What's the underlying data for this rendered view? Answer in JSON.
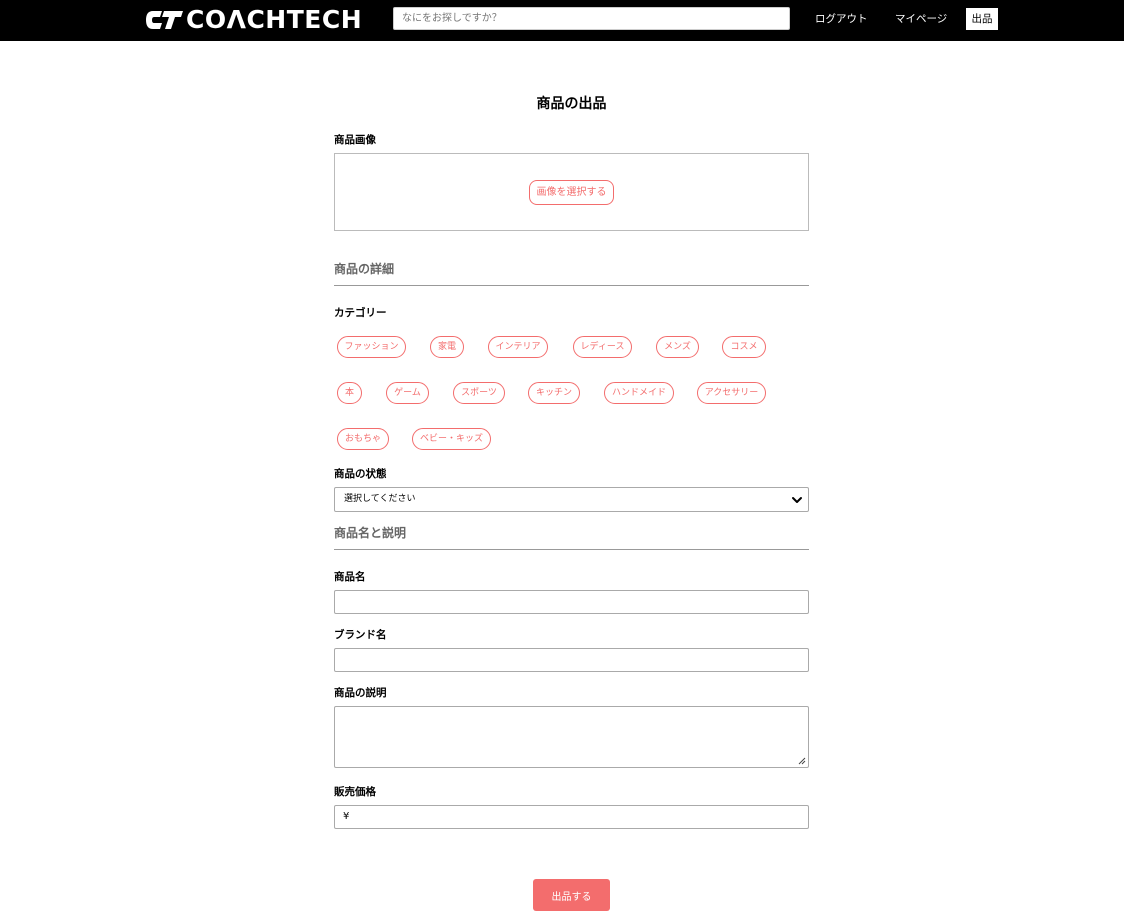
{
  "header": {
    "logo_text": "COΛCHTECH",
    "search_placeholder": "なにをお探しですか？",
    "logout_label": "ログアウト",
    "mypage_label": "マイページ",
    "sell_label": "出品"
  },
  "form": {
    "title": "商品の出品",
    "image_label": "商品画像",
    "image_button": "画像を選択する",
    "details_section": "商品の詳細",
    "category_label": "カテゴリー",
    "categories": [
      "ファッション",
      "家電",
      "インテリア",
      "レディース",
      "メンズ",
      "コスメ",
      "本",
      "ゲーム",
      "スポーツ",
      "キッチン",
      "ハンドメイド",
      "アクセサリー",
      "おもちゃ",
      "ベビー・キッズ"
    ],
    "condition_label": "商品の状態",
    "condition_selected": "選択してください",
    "name_section": "商品名と説明",
    "name_label": "商品名",
    "brand_label": "ブランド名",
    "description_label": "商品の説明",
    "price_label": "販売価格",
    "price_prefix": "¥",
    "submit_label": "出品する"
  },
  "colors": {
    "accent": "#f36d6d",
    "header_bg": "#000000"
  }
}
